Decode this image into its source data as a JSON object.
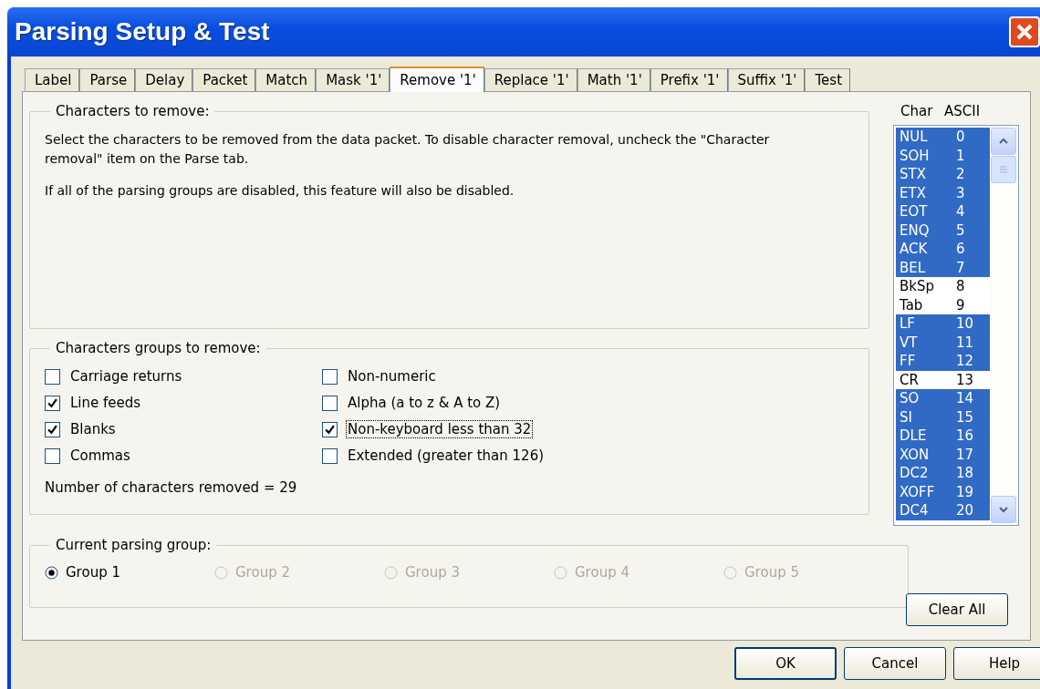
{
  "window": {
    "title": "Parsing Setup & Test"
  },
  "tabs": [
    {
      "label": "Label",
      "selected": false
    },
    {
      "label": "Parse",
      "selected": false
    },
    {
      "label": "Delay",
      "selected": false
    },
    {
      "label": "Packet",
      "selected": false
    },
    {
      "label": "Match",
      "selected": false
    },
    {
      "label": "Mask '1'",
      "selected": false
    },
    {
      "label": "Remove '1'",
      "selected": true
    },
    {
      "label": "Replace '1'",
      "selected": false
    },
    {
      "label": "Math '1'",
      "selected": false
    },
    {
      "label": "Prefix '1'",
      "selected": false
    },
    {
      "label": "Suffix '1'",
      "selected": false
    },
    {
      "label": "Test",
      "selected": false
    }
  ],
  "remove_group": {
    "title": "Characters to remove:",
    "paragraphs": [
      "Select the characters to be removed from the data packet.  To disable character removal, uncheck the \"Character removal\" item on the Parse tab.",
      "If all of the parsing groups are disabled, this feature will also be disabled."
    ]
  },
  "groups_group": {
    "title": "Characters groups to remove:",
    "checkboxes": [
      {
        "label": "Carriage returns",
        "checked": false,
        "focused": false
      },
      {
        "label": "Non-numeric",
        "checked": false,
        "focused": false
      },
      {
        "label": "Line feeds",
        "checked": true,
        "focused": false
      },
      {
        "label": "Alpha (a to z & A to Z)",
        "checked": false,
        "focused": false
      },
      {
        "label": "Blanks",
        "checked": true,
        "focused": false
      },
      {
        "label": "Non-keyboard less than 32",
        "checked": true,
        "focused": true
      },
      {
        "label": "Commas",
        "checked": false,
        "focused": false
      },
      {
        "label": "Extended (greater than 126)",
        "checked": false,
        "focused": false
      }
    ],
    "count_text": "Number of characters removed = 29"
  },
  "parsing_group": {
    "title": "Current parsing group:",
    "radios": [
      {
        "label": "Group 1",
        "selected": true,
        "disabled": false
      },
      {
        "label": "Group 2",
        "selected": false,
        "disabled": true
      },
      {
        "label": "Group 3",
        "selected": false,
        "disabled": true
      },
      {
        "label": "Group 4",
        "selected": false,
        "disabled": true
      },
      {
        "label": "Group 5",
        "selected": false,
        "disabled": true
      }
    ]
  },
  "char_list": {
    "columns": [
      "Char",
      "ASCII"
    ],
    "rows": [
      {
        "char": "NUL",
        "ascii": "0",
        "selected": true
      },
      {
        "char": "SOH",
        "ascii": "1",
        "selected": true
      },
      {
        "char": "STX",
        "ascii": "2",
        "selected": true
      },
      {
        "char": "ETX",
        "ascii": "3",
        "selected": true
      },
      {
        "char": "EOT",
        "ascii": "4",
        "selected": true
      },
      {
        "char": "ENQ",
        "ascii": "5",
        "selected": true
      },
      {
        "char": "ACK",
        "ascii": "6",
        "selected": true
      },
      {
        "char": "BEL",
        "ascii": "7",
        "selected": true
      },
      {
        "char": "BkSp",
        "ascii": "8",
        "selected": false
      },
      {
        "char": "Tab",
        "ascii": "9",
        "selected": false
      },
      {
        "char": "LF",
        "ascii": "10",
        "selected": true
      },
      {
        "char": "VT",
        "ascii": "11",
        "selected": true
      },
      {
        "char": "FF",
        "ascii": "12",
        "selected": true
      },
      {
        "char": "CR",
        "ascii": "13",
        "selected": false
      },
      {
        "char": "SO",
        "ascii": "14",
        "selected": true
      },
      {
        "char": "SI",
        "ascii": "15",
        "selected": true
      },
      {
        "char": "DLE",
        "ascii": "16",
        "selected": true
      },
      {
        "char": "XON",
        "ascii": "17",
        "selected": true
      },
      {
        "char": "DC2",
        "ascii": "18",
        "selected": true
      },
      {
        "char": "XOFF",
        "ascii": "19",
        "selected": true
      },
      {
        "char": "DC4",
        "ascii": "20",
        "selected": true
      }
    ],
    "clear_button": "Clear All"
  },
  "buttons": [
    {
      "label": "OK",
      "default": true
    },
    {
      "label": "Cancel",
      "default": false
    },
    {
      "label": "Help",
      "default": false
    }
  ]
}
